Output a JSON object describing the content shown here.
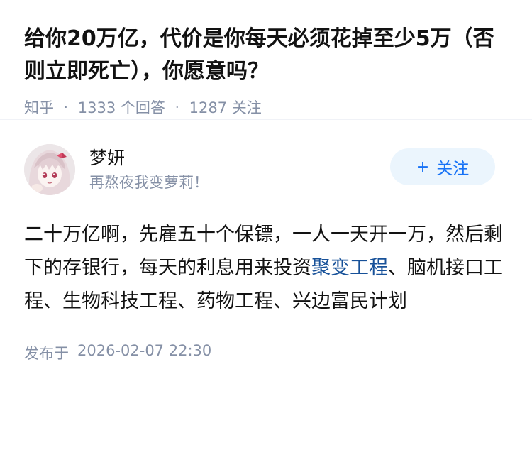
{
  "question": {
    "title": "给你20万亿，代价是你每天必须花掉至少5万（否则立即死亡），你愿意吗？",
    "source": "知乎",
    "answers_count": "1333 个回答",
    "followers_count": "1287 关注",
    "separator": "·"
  },
  "author": {
    "name": "梦妍",
    "bio": "再熬夜我变萝莉！",
    "follow_plus": "+",
    "follow_label": "关注"
  },
  "answer": {
    "text_part1": "二十万亿啊，先雇五十个保镖，一人一天开一万，然后剩下的存银行，每天的利息用来投资",
    "link_text": "聚变工程",
    "text_part2": "、脑机接口工程、生物科技工程、药物工程、兴边富民计划",
    "published_label": "发布于",
    "published_time": "2026-02-07 22:30"
  },
  "colors": {
    "link": "#175199",
    "meta": "#8590a6",
    "follow_bg": "#ebf5fd",
    "follow_text": "#1772f6"
  }
}
